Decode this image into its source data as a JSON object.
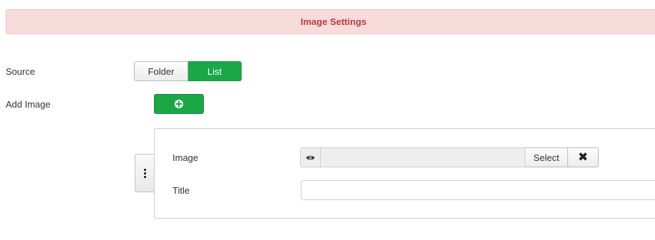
{
  "section": {
    "title": "Image Settings"
  },
  "source": {
    "label": "Source",
    "options": [
      "Folder",
      "List"
    ],
    "selected": "List"
  },
  "add_image": {
    "label": "Add Image",
    "icon": "plus-circle-icon"
  },
  "item": {
    "image_label": "Image",
    "image_value": "",
    "select_label": "Select",
    "clear_glyph": "✖",
    "title_label": "Title",
    "title_value": ""
  },
  "colors": {
    "header_bg": "#f8dbdb",
    "header_text": "#bd3b3b",
    "success": "#1aa847"
  }
}
